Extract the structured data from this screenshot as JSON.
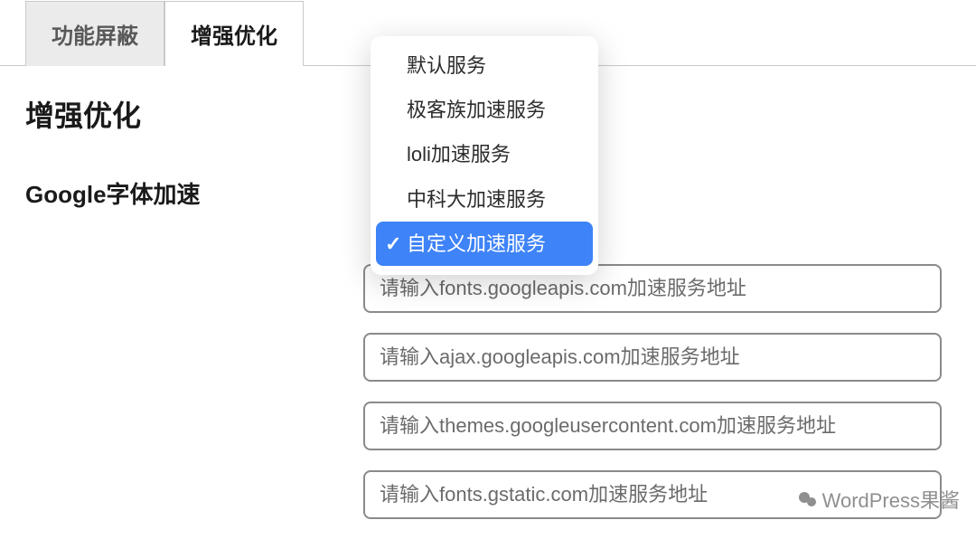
{
  "tabs": [
    {
      "label": "功能屏蔽"
    },
    {
      "label": "增强优化"
    }
  ],
  "page_title": "增强优化",
  "section_label": "Google字体加速",
  "dropdown": {
    "items": [
      {
        "label": "默认服务"
      },
      {
        "label": "极客族加速服务"
      },
      {
        "label": "loli加速服务"
      },
      {
        "label": "中科大加速服务"
      },
      {
        "label": "自定义加速服务"
      }
    ],
    "selected_index": 4,
    "checkmark": "✓"
  },
  "inputs": [
    {
      "placeholder": "请输入fonts.googleapis.com加速服务地址"
    },
    {
      "placeholder": "请输入ajax.googleapis.com加速服务地址"
    },
    {
      "placeholder": "请输入themes.googleusercontent.com加速服务地址"
    },
    {
      "placeholder": "请输入fonts.gstatic.com加速服务地址"
    }
  ],
  "watermark": "WordPress果酱"
}
